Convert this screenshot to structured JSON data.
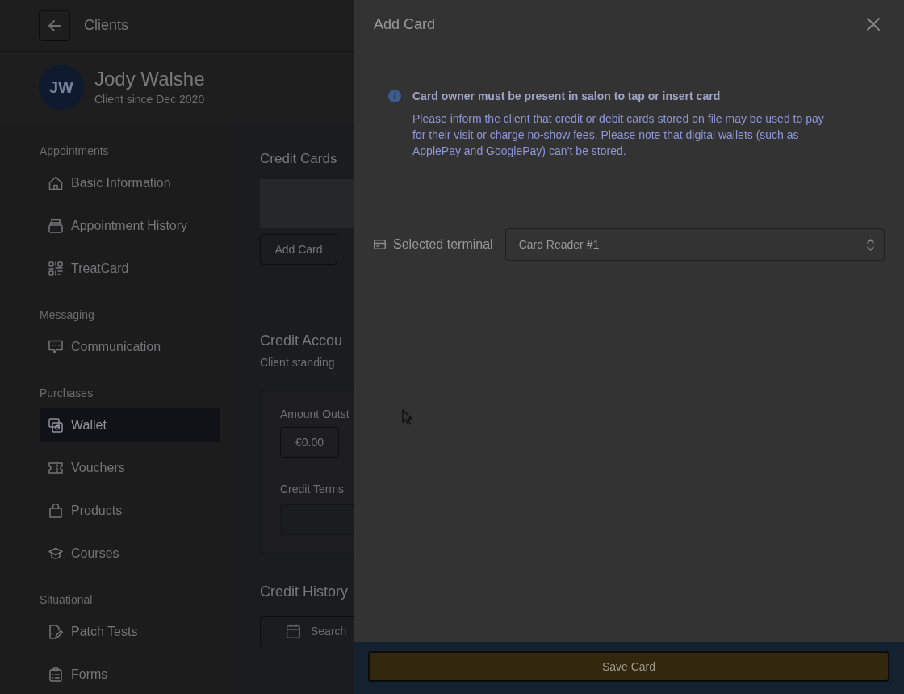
{
  "header": {
    "title": "Clients"
  },
  "client": {
    "initials": "JW",
    "name": "Jody Walshe",
    "since": "Client since Dec 2020"
  },
  "sidebar": {
    "sections": [
      {
        "label": "Appointments",
        "items": [
          {
            "label": "Basic Information",
            "selected": false
          },
          {
            "label": "Appointment History",
            "selected": false
          },
          {
            "label": "TreatCard",
            "selected": false
          }
        ]
      },
      {
        "label": "Messaging",
        "items": [
          {
            "label": "Communication",
            "selected": false
          }
        ]
      },
      {
        "label": "Purchases",
        "items": [
          {
            "label": "Wallet",
            "selected": true
          },
          {
            "label": "Vouchers",
            "selected": false
          },
          {
            "label": "Products",
            "selected": false
          },
          {
            "label": "Courses",
            "selected": false
          }
        ]
      },
      {
        "label": "Situational",
        "items": [
          {
            "label": "Patch Tests",
            "selected": false
          },
          {
            "label": "Forms",
            "selected": false
          }
        ]
      }
    ]
  },
  "content": {
    "credit_cards": {
      "title": "Credit Cards",
      "button": "Add Card"
    },
    "credit_account": {
      "title": "Credit Accou",
      "subtitle": "Client standing",
      "fields": [
        {
          "label": "Amount Outst",
          "value": "€0.00"
        },
        {
          "label": "Credit Terms"
        }
      ]
    },
    "credit_history": {
      "title": "Credit History",
      "search": {
        "placeholder": "Search"
      }
    }
  },
  "panel": {
    "title": "Add Card",
    "notice": {
      "title": "Card owner must be present in salon to tap or insert card",
      "text": "Please inform the client that credit or debit cards stored on file may be used to pay for their visit or charge no-show fees. Please note that digital wallets (such as ApplePay and GooglePay) can’t be stored."
    },
    "terminal": {
      "label": "Selected terminal",
      "value": "Card Reader #1"
    },
    "save_button": "Save Card"
  }
}
